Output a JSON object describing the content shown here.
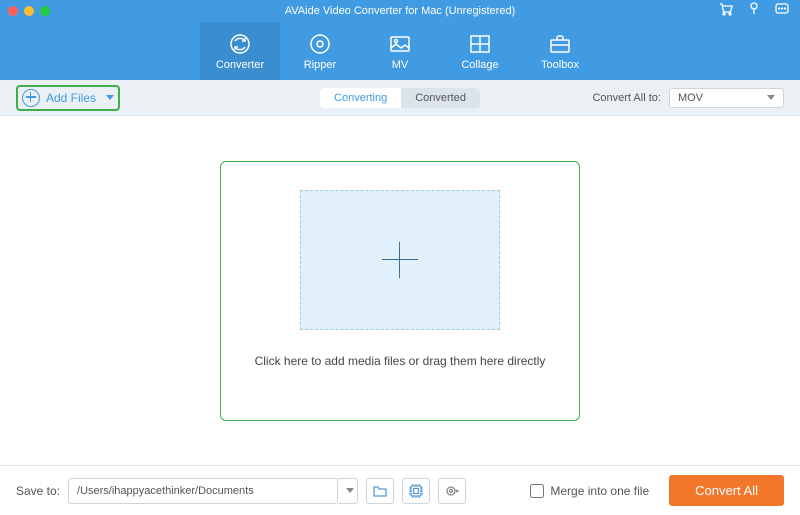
{
  "title": "AVAide Video Converter for Mac (Unregistered)",
  "menu": {
    "converter": "Converter",
    "ripper": "Ripper",
    "mv": "MV",
    "collage": "Collage",
    "toolbox": "Toolbox"
  },
  "toolbar": {
    "add_files": "Add Files",
    "tab_converting": "Converting",
    "tab_converted": "Converted",
    "convert_all_to": "Convert All to:",
    "output_format": "MOV"
  },
  "drop": {
    "text": "Click here to add media files or drag them here directly"
  },
  "footer": {
    "save_to": "Save to:",
    "path": "/Users/ihappyacethinker/Documents",
    "merge": "Merge into one file",
    "convert_all": "Convert All"
  }
}
